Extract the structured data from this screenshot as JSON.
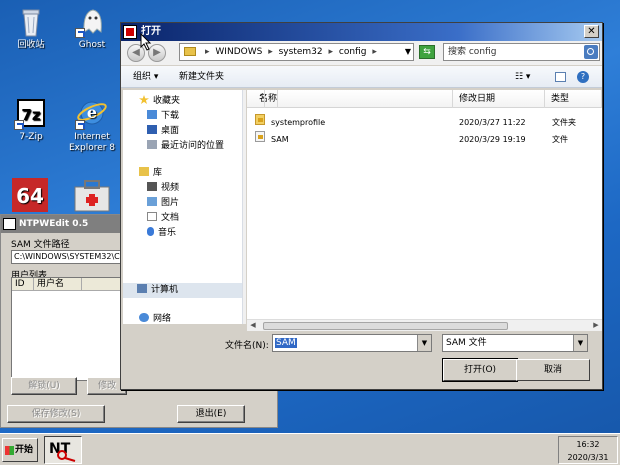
{
  "desktop": {
    "icons": [
      {
        "label": "回收站"
      },
      {
        "label": "Ghost"
      },
      {
        "label": "7-Zip"
      },
      {
        "label": "Internet Explorer 8",
        "label_line1": "Internet",
        "label_line2": "Explorer 8"
      }
    ]
  },
  "ntpwedit": {
    "title": "NTPWEdit 0.5",
    "sam_path_label": "SAM 文件路径",
    "sam_path_value": "C:\\WINDOWS\\SYSTEM32\\CO",
    "user_list_label": "用户列表",
    "columns": [
      "ID",
      "用户名"
    ],
    "unlock_button": "解锁(U)",
    "change_button": "修改",
    "save_button": "保存修改(S)",
    "exit_button": "退出(E)"
  },
  "dialog": {
    "title": "打开",
    "close_label": "✕",
    "breadcrumb": [
      "WINDOWS",
      "system32",
      "config"
    ],
    "search_placeholder": "搜索 config",
    "organize_label": "组织 ▾",
    "new_folder_label": "新建文件夹",
    "nav": {
      "favorites": "收藏夹",
      "downloads": "下载",
      "desktop": "桌面",
      "recent": "最近访问的位置",
      "libraries": "库",
      "videos": "视频",
      "pictures": "图片",
      "documents": "文档",
      "music": "音乐",
      "computer": "计算机",
      "network": "网络"
    },
    "columns": {
      "name": "名称",
      "date": "修改日期",
      "type": "类型"
    },
    "files": [
      {
        "name": "systemprofile",
        "date": "2020/3/27 11:22",
        "type": "文件夹"
      },
      {
        "name": "SAM",
        "date": "2020/3/29 19:19",
        "type": "文件"
      }
    ],
    "filename_label": "文件名(N):",
    "filename_value": "SAM",
    "filetype_value": "SAM 文件",
    "open_button": "打开(O)",
    "cancel_button": "取消"
  },
  "taskbar": {
    "start_label": "开始",
    "time": "16:32",
    "date": "2020/3/31"
  },
  "colors": {
    "desktop": "#1d68c4",
    "title_active": "#0a246a",
    "selection": "#3169c6"
  }
}
